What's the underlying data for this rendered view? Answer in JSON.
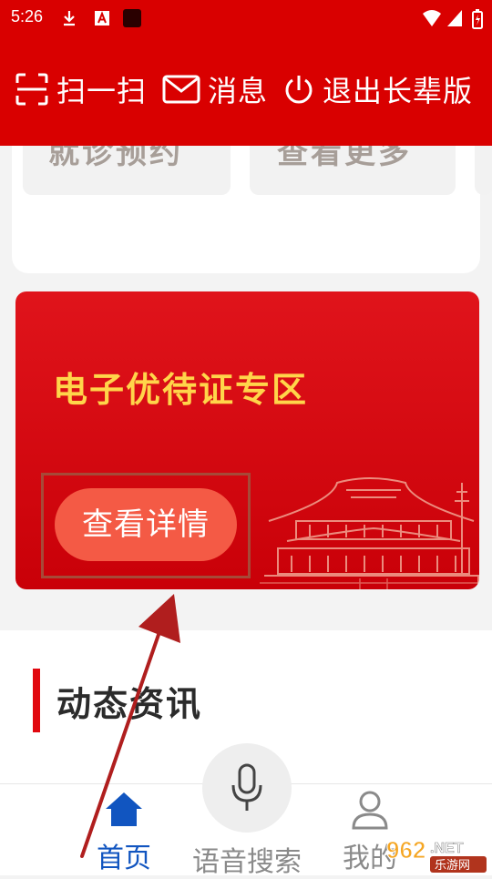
{
  "status_bar": {
    "time": "5:26"
  },
  "header": {
    "scan_label": "扫一扫",
    "message_label": "消息",
    "exit_label": "退出长辈版"
  },
  "top_card": {
    "tile_1_text": "就诊预约",
    "tile_2_text": "查看更多"
  },
  "banner": {
    "title": "电子优待证专区",
    "button_label": "查看详情"
  },
  "news": {
    "section_title": "动态资讯"
  },
  "tabbar": {
    "home_label": "首页",
    "voice_label": "语音搜索",
    "mine_label": "我的"
  },
  "watermark": {
    "brand": "962",
    "suffix": ".NET",
    "subtitle": "乐游网"
  },
  "colors": {
    "header_red": "#d90000",
    "banner_red": "#e0141b",
    "title_yellow": "#ffd54a",
    "button_coral": "#f45a45",
    "active_tab_blue": "#1155c0"
  }
}
